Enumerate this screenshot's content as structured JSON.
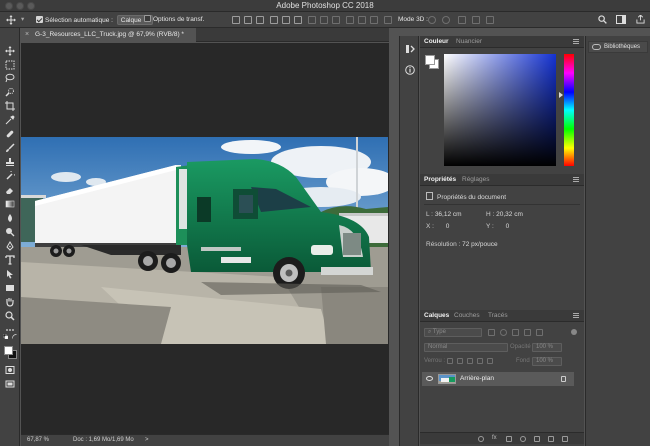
{
  "window": {
    "title": "Adobe Photoshop CC 2018"
  },
  "options_bar": {
    "auto_select_label": "Sélection automatique :",
    "auto_select_checked": true,
    "auto_select_value": "Calque",
    "transform_label": "Options de transf.",
    "transform_checked": false,
    "mode3d_label": "Mode 3D :"
  },
  "document": {
    "tab_title": "G-3_Resources_LLC_Truck.jpg @ 67,9% (RVB/8) *",
    "close_glyph": "×"
  },
  "status_bar": {
    "zoom": "67,87 %",
    "doc_info": "Doc : 1,69 Mo/1,69 Mo",
    "arrow": ">"
  },
  "color_panel": {
    "tabs": [
      "Couleur",
      "Nuancier"
    ],
    "active_tab": 0,
    "fg_color": "#ffffff",
    "hue_color": "#1432d2"
  },
  "properties_panel": {
    "tabs": [
      "Propriétés",
      "Réglages"
    ],
    "active_tab": 0,
    "section_title": "Propriétés du document",
    "width_label": "L :",
    "width_value": "36,12 cm",
    "height_label": "H :",
    "height_value": "20,32 cm",
    "x_label": "X :",
    "x_value": "0",
    "y_label": "Y :",
    "y_value": "0",
    "resolution_label": "Résolution :",
    "resolution_value": "72 px/pouce"
  },
  "layers_panel": {
    "tabs": [
      "Calques",
      "Couches",
      "Tracés"
    ],
    "active_tab": 0,
    "filter_placeholder": "Type",
    "blend_mode": "Normal",
    "opacity_label": "Opacité :",
    "opacity_value": "100 %",
    "lock_label": "Verrou :",
    "fill_label": "Fond :",
    "fill_value": "100 %",
    "layers": [
      {
        "name": "Arrière-plan",
        "visible": true,
        "locked": true
      }
    ]
  },
  "libraries": {
    "label": "Bibliothèques"
  }
}
